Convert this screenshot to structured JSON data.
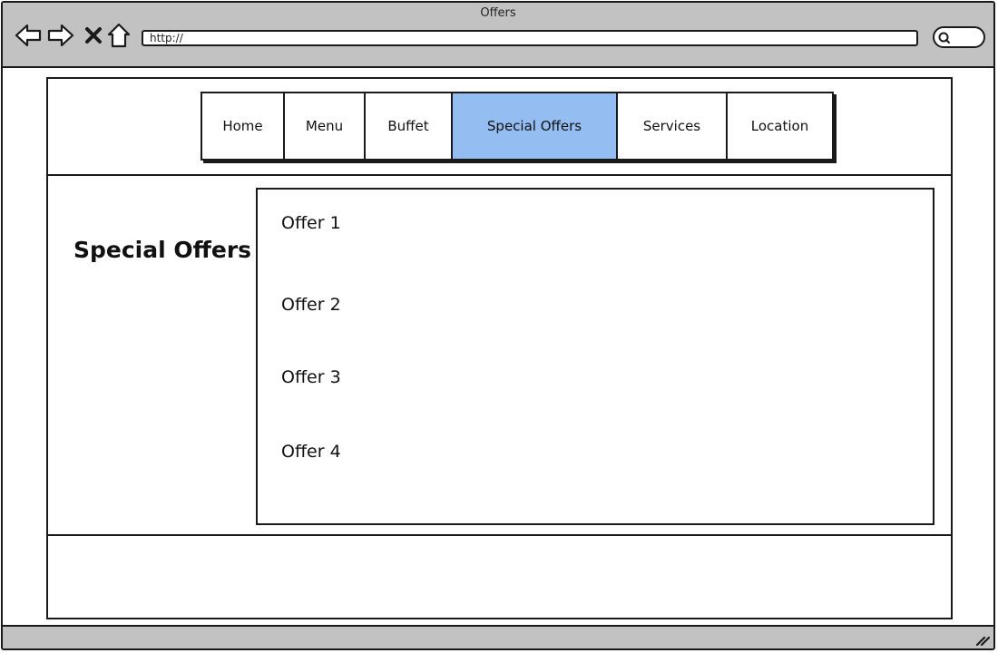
{
  "window": {
    "title": "Offers"
  },
  "toolbar": {
    "address": "http://",
    "back_icon": "back-arrow-icon",
    "forward_icon": "forward-arrow-icon",
    "close_icon": "close-x-icon",
    "home_icon": "home-icon",
    "search_icon": "search-icon"
  },
  "nav": {
    "tabs": [
      {
        "label": "Home",
        "active": false
      },
      {
        "label": "Menu",
        "active": false
      },
      {
        "label": "Buffet",
        "active": false
      },
      {
        "label": "Special Offers",
        "active": true
      },
      {
        "label": "Services",
        "active": false
      },
      {
        "label": "Location",
        "active": false
      }
    ],
    "active_color": "#94bdf2"
  },
  "main": {
    "heading": "Special Offers",
    "offers": [
      "Offer 1",
      "Offer 2",
      "Offer 3",
      "Offer 4"
    ]
  },
  "colors": {
    "chrome": "#c2c2c2",
    "outline": "#1a1a1a",
    "active_tab": "#94bdf2"
  }
}
